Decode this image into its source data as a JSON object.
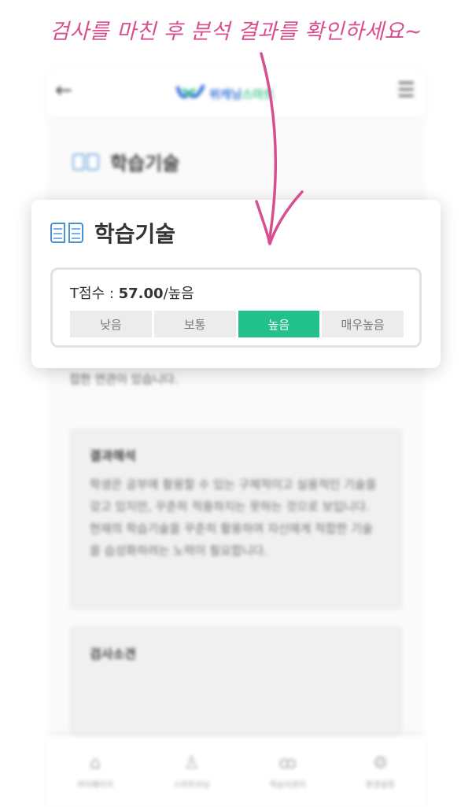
{
  "headline": "검사를 마친 후 분석 결과를 확인하세요~",
  "background_screen": {
    "header": {
      "logo_text_a": "위캐닝",
      "logo_text_b": "스마트"
    },
    "section_title": "학습기술",
    "description": "접한 연관이 있습니다.",
    "result_card": {
      "title": "결과해석",
      "body": "학생은 공부에 활용할 수 있는 구체적이고 실용적인 기술을 갖고 있지만, 꾸준히 적용하지는 못하는 것으로 보입니다. 현재의 학습기술을 꾸준히 활용하여 자신에게 적합한 기술을 습성화하려는 노력이 필요합니다."
    },
    "opinion_card": {
      "title": "검사소견"
    },
    "bottom_nav": [
      {
        "icon": "home-icon",
        "label": "마이페이지"
      },
      {
        "icon": "person-icon",
        "label": "스마트러닝"
      },
      {
        "icon": "people-icon",
        "label": "학습자관리"
      },
      {
        "icon": "gear-icon",
        "label": "환경설정"
      }
    ]
  },
  "popup": {
    "title": "학습기술",
    "score_label": "T점수 : ",
    "score_value": "57.00",
    "score_suffix": "/높음",
    "levels": [
      "낮음",
      "보통",
      "높음",
      "매우높음"
    ],
    "active_level": "높음",
    "active_color": "#22c08a"
  },
  "colors": {
    "headline": "#d84f8f",
    "arrow": "#d84f8f"
  }
}
